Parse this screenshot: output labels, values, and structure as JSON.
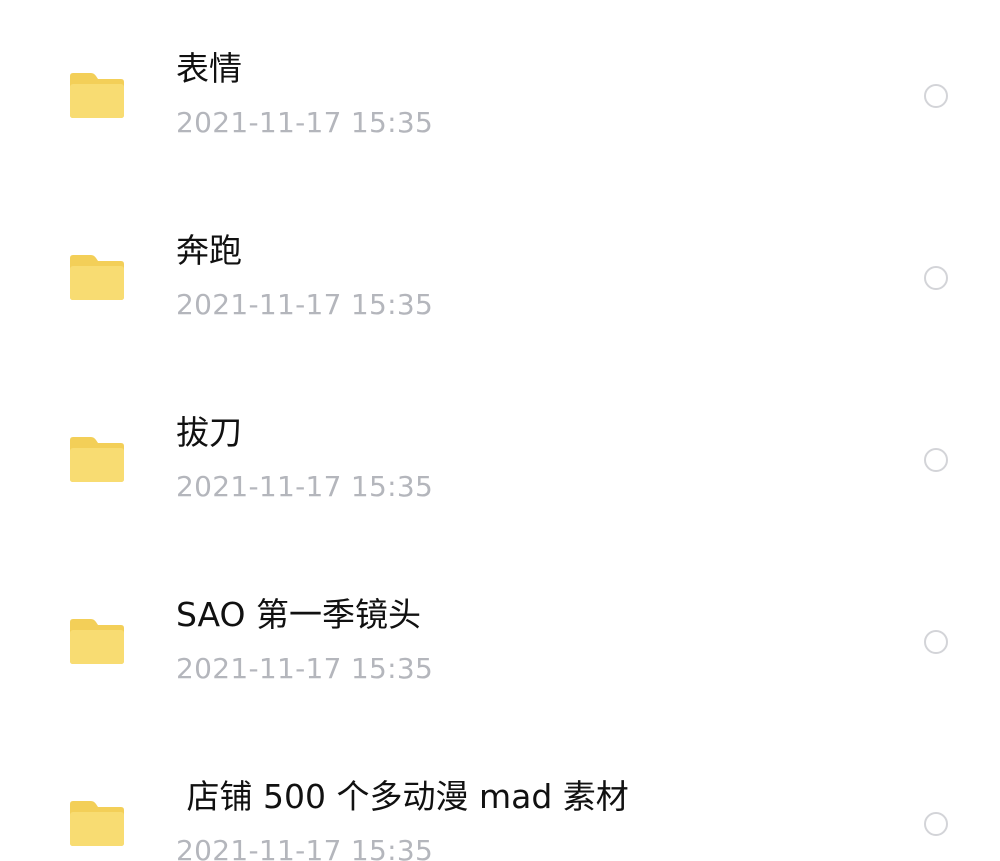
{
  "files": [
    {
      "name": "表情",
      "date": "2021-11-17 15:35",
      "icon": "folder-icon"
    },
    {
      "name": "奔跑",
      "date": "2021-11-17 15:35",
      "icon": "folder-icon"
    },
    {
      "name": "拔刀",
      "date": "2021-11-17 15:35",
      "icon": "folder-icon"
    },
    {
      "name": "SAO 第一季镜头",
      "date": "2021-11-17 15:35",
      "icon": "folder-icon"
    },
    {
      "name": " 店铺 500 个多动漫 mad 素材",
      "date": "2021-11-17 15:35",
      "icon": "folder-icon"
    }
  ],
  "colors": {
    "folder": "#f8dc72",
    "folder_tab": "#f3cf58",
    "name_text": "#111111",
    "date_text": "#b4b6bc",
    "radio_border": "#d3d4d8"
  }
}
